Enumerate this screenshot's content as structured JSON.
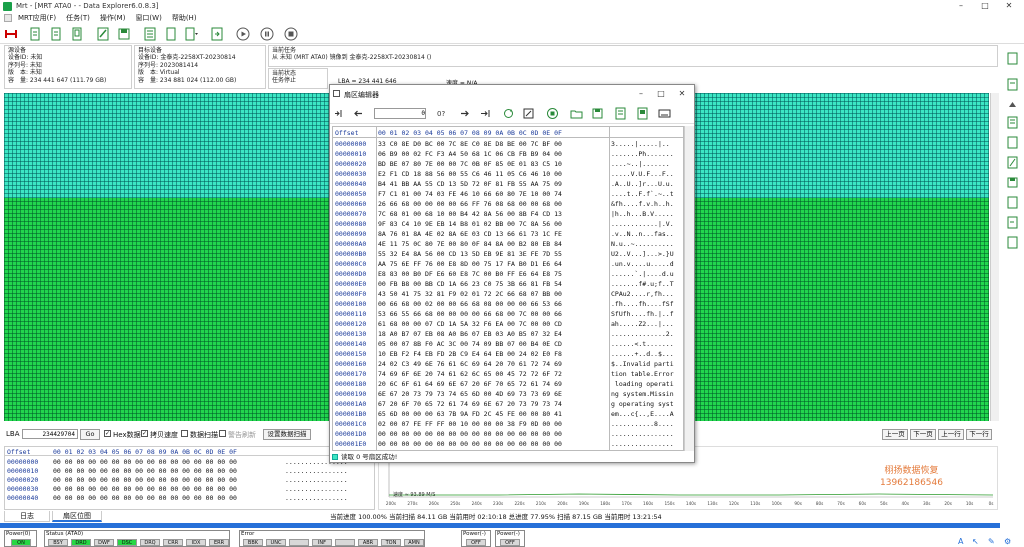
{
  "window": {
    "title": "Mrt - [MRT ATA0 - - Data Explorer6.0.8.3]"
  },
  "menu": [
    "MRT应用(F)",
    "任务(T)",
    "操作(M)",
    "窗口(W)",
    "帮助(H)"
  ],
  "info": {
    "source": {
      "heading": "源设备",
      "id": "设备ID: 未知",
      "serial": "序列号: 未知",
      "version": "版　本: 未知",
      "capacity": "容　量: 234 441 647 (111.79 GB)"
    },
    "target": {
      "heading": "目标设备",
      "id": "设备ID: 金泰克-2258XT-20230814",
      "serial": "序列号: 2023081414",
      "version": "版　本: Virtual",
      "capacity": "容　量: 234 881 024 (112.00 GB)"
    },
    "task": {
      "heading": "当前任务",
      "text": "从 未知 (MRT ATA0) 镜像到 金泰克-2258XT-20230814 ()",
      "state_heading": "当前状态",
      "state": "任务停止"
    },
    "lba": "LBA = 234 441 646",
    "speed": "速度 = N/A"
  },
  "lba_row": {
    "label": "LBA",
    "value": "234429704",
    "go": "Go",
    "hex_label": "Hex数据",
    "copy_speed": "拷贝速度",
    "data_scan": "数据扫描",
    "alarm": "警告刷新",
    "set_scan": "设置数据扫描",
    "prev_page": "上一页",
    "next_page": "下一页",
    "prev_row": "上一行",
    "next_row": "下一行"
  },
  "bottom_hex": {
    "header_offset": "Offset",
    "header_cols": "00 01 02 03 04 05 06 07 08 09 0A 0B 0C 0D 0E 0F",
    "rows": [
      {
        "off": "00000000",
        "hex": "00 00 00 00 00 00 00 00 00 00 00 00 00 00 00 00",
        "asc": "................"
      },
      {
        "off": "00000010",
        "hex": "00 00 00 00 00 00 00 00 00 00 00 00 00 00 00 00",
        "asc": "................"
      },
      {
        "off": "00000020",
        "hex": "00 00 00 00 00 00 00 00 00 00 00 00 00 00 00 00",
        "asc": "................"
      },
      {
        "off": "00000030",
        "hex": "00 00 00 00 00 00 00 00 00 00 00 00 00 00 00 00",
        "asc": "................"
      },
      {
        "off": "00000040",
        "hex": "00 00 00 00 00 00 00 00 00 00 00 00 00 00 00 00",
        "asc": "................"
      }
    ]
  },
  "graph": {
    "ticks": [
      "200s",
      "270s",
      "260s",
      "250s",
      "240s",
      "230s",
      "220s",
      "210s",
      "200s",
      "190s",
      "180s",
      "170s",
      "160s",
      "150s",
      "140s",
      "130s",
      "120s",
      "110s",
      "100s",
      "90s",
      "80s",
      "70s",
      "60s",
      "50s",
      "40s",
      "30s",
      "20s",
      "10s",
      "0s"
    ],
    "legend": "速度 ≈ 93.89 M/S"
  },
  "tabs": [
    "日志",
    "扇区位图"
  ],
  "progress": {
    "text": "当前进度 100.00%   当前扫描 84.11 GB   当前用时 02:10:18      总进度 77.95%  扫描 87.15 GB  当前用时 13:21:54"
  },
  "status": {
    "power0": {
      "label": "Power(0)",
      "leds": [
        "ON"
      ]
    },
    "status": {
      "label": "Status (ATA0)",
      "leds": [
        "BSY",
        "DRD",
        "DWF",
        "DSC",
        "DRQ",
        "CRR",
        "IDX",
        "ERR"
      ]
    },
    "error": {
      "label": "Error",
      "leds": [
        "BBK",
        "UNC",
        "",
        "INF",
        "",
        "ABR",
        "TON",
        "AMN"
      ]
    },
    "power1": {
      "label": "Power(-)",
      "leds": [
        "OFF"
      ]
    },
    "power2": {
      "label": "Power(-)",
      "leds": [
        "OFF"
      ]
    }
  },
  "dialog": {
    "title": "扇区编辑器",
    "nav_value": "0",
    "status": "读取 0 号扇区成功!",
    "header_offset": "Offset",
    "header_cols": "00 01 02 03 04 05 06 07 08 09 0A 0B 0C 0D 0E 0F",
    "rows": [
      {
        "off": "00000000",
        "hex": "33 C0 8E D0 BC 00 7C 8E C0 8E D8 BE 00 7C BF 00",
        "asc": "3.....|.....|.."
      },
      {
        "off": "00000010",
        "hex": "06 B9 00 02 FC F3 A4 50 68 1C 06 CB FB B9 04 00",
        "asc": ".......Ph......."
      },
      {
        "off": "00000020",
        "hex": "BD BE 07 80 7E 00 00 7C 0B 0F 85 0E 01 83 C5 10",
        "asc": "....~..|......."
      },
      {
        "off": "00000030",
        "hex": "E2 F1 CD 18 88 56 00 55 C6 46 11 05 C6 46 10 00",
        "asc": ".....V.U.F...F.."
      },
      {
        "off": "00000040",
        "hex": "B4 41 BB AA 55 CD 13 5D 72 0F 81 FB 55 AA 75 09",
        "asc": ".A..U..]r...U.u."
      },
      {
        "off": "00000050",
        "hex": "F7 C1 01 00 74 03 FE 46 10 66 60 80 7E 10 00 74",
        "asc": "....t..F.f`.~..t"
      },
      {
        "off": "00000060",
        "hex": "26 66 68 00 00 00 00 66 FF 76 08 68 00 00 68 00",
        "asc": "&fh....f.v.h..h."
      },
      {
        "off": "00000070",
        "hex": "7C 68 01 00 68 10 00 B4 42 8A 56 00 8B F4 CD 13",
        "asc": "|h..h...B.V....."
      },
      {
        "off": "00000080",
        "hex": "9F 83 C4 10 9E EB 14 B8 01 02 BB 00 7C 8A 56 00",
        "asc": "............|.V."
      },
      {
        "off": "00000090",
        "hex": "8A 76 01 8A 4E 02 8A 6E 03 CD 13 66 61 73 1C FE",
        "asc": ".v..N..n...fas.."
      },
      {
        "off": "000000A0",
        "hex": "4E 11 75 0C 80 7E 00 80 0F 84 8A 00 B2 80 EB 84",
        "asc": "N.u..~.........."
      },
      {
        "off": "000000B0",
        "hex": "55 32 E4 8A 56 00 CD 13 5D EB 9E 81 3E FE 7D 55",
        "asc": "U2..V...]...>.}U"
      },
      {
        "off": "000000C0",
        "hex": "AA 75 6E FF 76 00 E8 8D 00 75 17 FA B0 D1 E6 64",
        "asc": ".un.v....u.....d"
      },
      {
        "off": "000000D0",
        "hex": "E8 83 00 B0 DF E6 60 E8 7C 00 B0 FF E6 64 E8 75",
        "asc": "......`.|....d.u"
      },
      {
        "off": "000000E0",
        "hex": "00 FB B8 00 BB CD 1A 66 23 C0 75 3B 66 81 FB 54",
        "asc": ".......f#.u;f..T"
      },
      {
        "off": "000000F0",
        "hex": "43 50 41 75 32 81 F9 02 01 72 2C 66 68 07 BB 00",
        "asc": "CPAu2....r,fh..."
      },
      {
        "off": "00000100",
        "hex": "00 66 68 00 02 00 00 66 68 08 00 00 00 66 53 66",
        "asc": ".fh....fh....fSf"
      },
      {
        "off": "00000110",
        "hex": "53 66 55 66 68 00 00 00 00 66 68 00 7C 00 00 66",
        "asc": "SfUfh....fh.|..f"
      },
      {
        "off": "00000120",
        "hex": "61 68 00 00 07 CD 1A 5A 32 F6 EA 00 7C 00 00 CD",
        "asc": "ah.....Z2...|..."
      },
      {
        "off": "00000130",
        "hex": "18 A0 B7 07 EB 08 A0 B6 07 EB 03 A0 B5 07 32 E4",
        "asc": "..............2."
      },
      {
        "off": "00000140",
        "hex": "05 00 07 8B F0 AC 3C 00 74 09 BB 07 00 B4 0E CD",
        "asc": "......<.t......."
      },
      {
        "off": "00000150",
        "hex": "10 EB F2 F4 EB FD 2B C9 E4 64 EB 00 24 02 E0 F8",
        "asc": "......+..d..$..."
      },
      {
        "off": "00000160",
        "hex": "24 02 C3 49 6E 76 61 6C 69 64 20 70 61 72 74 69",
        "asc": "$..Invalid parti"
      },
      {
        "off": "00000170",
        "hex": "74 69 6F 6E 20 74 61 62 6C 65 00 45 72 72 6F 72",
        "asc": "tion table.Error"
      },
      {
        "off": "00000180",
        "hex": "20 6C 6F 61 64 69 6E 67 20 6F 70 65 72 61 74 69",
        "asc": " loading operati"
      },
      {
        "off": "00000190",
        "hex": "6E 67 20 73 79 73 74 65 6D 00 4D 69 73 73 69 6E",
        "asc": "ng system.Missin"
      },
      {
        "off": "000001A0",
        "hex": "67 20 6F 70 65 72 61 74 69 6E 67 20 73 79 73 74",
        "asc": "g operating syst"
      },
      {
        "off": "000001B0",
        "hex": "65 6D 00 00 00 63 7B 9A FD 2C 45 FE 00 00 80 41",
        "asc": "em...c{..,E....A"
      },
      {
        "off": "000001C0",
        "hex": "02 00 07 FE FF FF 00 10 00 00 00 38 F9 0D 00 00",
        "asc": "...........8...."
      },
      {
        "off": "000001D0",
        "hex": "00 00 00 00 00 00 00 00 00 00 00 00 00 00 00 00",
        "asc": "................"
      },
      {
        "off": "000001E0",
        "hex": "00 00 00 00 00 00 00 00 00 00 00 00 00 00 00 00",
        "asc": "................"
      },
      {
        "off": "000001F0",
        "hex": "00 00 00 00 00 00 00 00 00 00 00 00 00 00 44 45",
        "asc": "..............DE"
      }
    ]
  },
  "watermark": {
    "line1": "栩扬数据恢复",
    "line2": "13962186546"
  },
  "colors": {
    "map_green": "#22d64e",
    "map_cyan": "#3ce6c4",
    "led_on": "#27d744",
    "progress_blue": "#2670d8",
    "accent_orange": "#e47b3c"
  }
}
